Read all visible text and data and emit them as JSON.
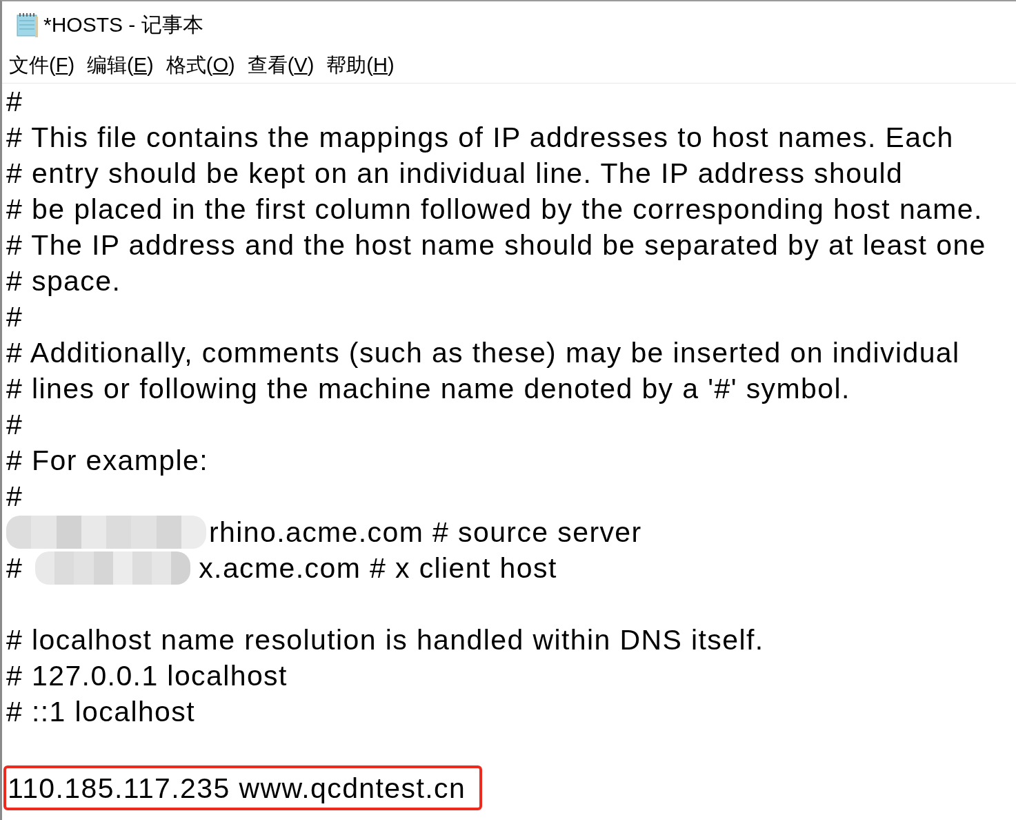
{
  "window": {
    "title": "*HOSTS - 记事本"
  },
  "menu": [
    {
      "before": "文件(",
      "accelerator": "F",
      "after": ")"
    },
    {
      "before": "编辑(",
      "accelerator": "E",
      "after": ")"
    },
    {
      "before": "格式(",
      "accelerator": "O",
      "after": ")"
    },
    {
      "before": "查看(",
      "accelerator": "V",
      "after": ")"
    },
    {
      "before": "帮助(",
      "accelerator": "H",
      "after": ")"
    }
  ],
  "editor": {
    "lines": [
      {
        "kind": "text",
        "text": "#"
      },
      {
        "kind": "text",
        "text": "# This file contains the mappings of IP addresses to host names. Each"
      },
      {
        "kind": "text",
        "text": "# entry should be kept on an individual line. The IP address should"
      },
      {
        "kind": "text",
        "text": "# be placed in the first column followed by the corresponding host name."
      },
      {
        "kind": "text",
        "text": "# The IP address and the host name should be separated by at least one"
      },
      {
        "kind": "text",
        "text": "# space."
      },
      {
        "kind": "text",
        "text": "#"
      },
      {
        "kind": "text",
        "text": "# Additionally, comments (such as these) may be inserted on individual"
      },
      {
        "kind": "text",
        "text": "# lines or following the machine name denoted by a '#' symbol."
      },
      {
        "kind": "text",
        "text": "#"
      },
      {
        "kind": "text",
        "text": "# For example:"
      },
      {
        "kind": "text",
        "text": "#"
      },
      {
        "kind": "redacted",
        "text": "rhino.acme.com # source server"
      },
      {
        "kind": "redacted",
        "prefix": "#",
        "text": "x.acme.com # x client host"
      },
      {
        "kind": "blank"
      },
      {
        "kind": "text",
        "text": "# localhost name resolution is handled within DNS itself."
      },
      {
        "kind": "text",
        "text": "# 127.0.0.1 localhost"
      },
      {
        "kind": "text",
        "text": "# ::1 localhost"
      },
      {
        "kind": "blank"
      },
      {
        "kind": "highlighted",
        "text": "110.185.117.235 www.qcdntest.cn"
      }
    ]
  }
}
